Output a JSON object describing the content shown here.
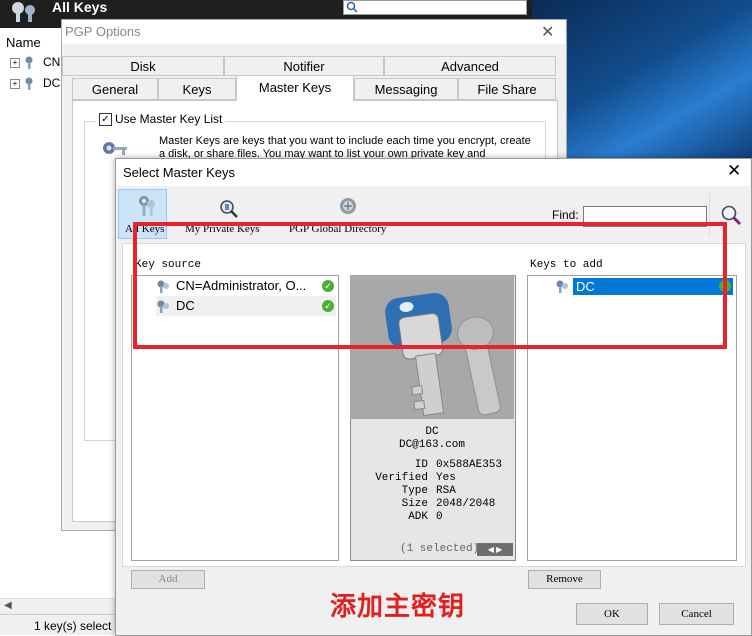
{
  "background_app": {
    "title": "All Keys",
    "column_header": "Name",
    "tree": [
      {
        "label": "CN"
      },
      {
        "label": "DC"
      }
    ],
    "status": "1 key(s) select"
  },
  "options_dialog": {
    "title": "PGP Options",
    "tabs_row1": [
      "Disk",
      "Notifier",
      "Advanced"
    ],
    "tabs_row2": [
      "General",
      "Keys",
      "Master Keys",
      "Messaging",
      "File Share"
    ],
    "active_tab": "Master Keys",
    "use_master_key_list": "Use Master Key List",
    "description": "Master Keys are keys that you want to include each time you encrypt, create a disk, or share files. You may want to list your own private key and"
  },
  "select_dialog": {
    "title": "Select Master Keys",
    "toolbar": {
      "all_keys": "All Keys",
      "my_private_keys": "My Private Keys",
      "pgp_global_directory": "PGP Global Directory",
      "find_label": "Find:",
      "find_value": ""
    },
    "key_source_label": "Key source",
    "key_source": [
      {
        "name": "CN=Administrator, O..."
      },
      {
        "name": "DC"
      }
    ],
    "keys_to_add_label": "Keys to add",
    "keys_to_add": [
      {
        "name": "DC"
      }
    ],
    "detail": {
      "name": "DC",
      "email": "DC@163.com",
      "fields": [
        {
          "key": "ID",
          "value": "0x588AE353"
        },
        {
          "key": "Verified",
          "value": "Yes"
        },
        {
          "key": "Type",
          "value": "RSA"
        },
        {
          "key": "Size",
          "value": "2048/2048"
        },
        {
          "key": "ADK",
          "value": "0"
        }
      ],
      "selected_count": "(1 selected)"
    },
    "buttons": {
      "add": "Add",
      "remove": "Remove",
      "ok": "OK",
      "cancel": "Cancel"
    }
  },
  "annotation": {
    "text": "添加主密钥",
    "color": "#e0201c",
    "box_color": "#e8232b"
  }
}
